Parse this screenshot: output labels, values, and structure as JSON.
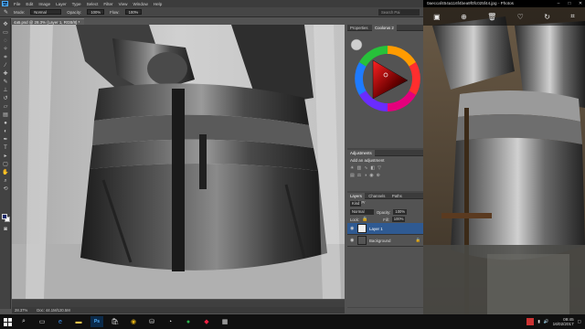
{
  "photoshop": {
    "logo": "Ps",
    "menu": [
      "File",
      "Edit",
      "Image",
      "Layer",
      "Type",
      "Select",
      "Filter",
      "View",
      "Window",
      "Help"
    ],
    "options": {
      "mode_label": "Mode:",
      "mode_value": "Normal",
      "opacity_label": "Opacity:",
      "opacity_value": "100%",
      "flow_label": "Flow:",
      "flow_value": "100%",
      "search_placeholder": "Search Pai"
    },
    "document_tab": "4a5.psd @ 28.3% (Layer 1, RGB/8) *",
    "status": {
      "zoom": "28.37%",
      "doc": "Doc: 44.1M/120.5M"
    },
    "panels": {
      "top_tabs": [
        "Properties",
        "Coolorus 2"
      ],
      "adjustments_tab": "Adjustments",
      "adjustments_title": "Add an adjustment",
      "layers_tabs": [
        "Layers",
        "Channels",
        "Paths",
        "Brush Pr"
      ],
      "kind_label": "Kind",
      "blend_mode": "Normal",
      "opacity_label": "Opacity:",
      "opacity_value": "100%",
      "lock_label": "Lock:",
      "fill_label": "Fill:",
      "fill_value": "100%",
      "layers": [
        {
          "name": "Layer 1",
          "selected": true
        },
        {
          "name": "Background",
          "selected": false
        }
      ]
    }
  },
  "photos": {
    "title": "0aeccaf454a116f4bea9f0fc025f44.jpg - Photos",
    "toolbar_icons": [
      "slideshow-icon",
      "zoom-icon",
      "delete-icon",
      "favorite-icon",
      "rotate-icon",
      "crop-icon"
    ]
  },
  "taskbar": {
    "time": "09:45",
    "date": "16/02/2017"
  },
  "colors": {
    "layer_selected": "#2f5a92",
    "foreground_swatch": "#1b2b6b"
  }
}
